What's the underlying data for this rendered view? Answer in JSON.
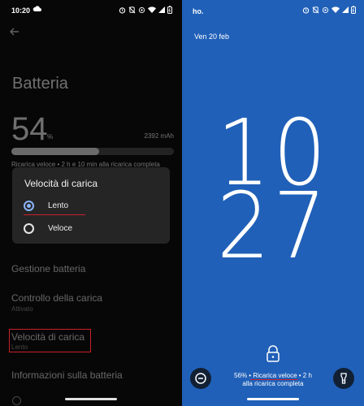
{
  "left": {
    "status_bar": {
      "time": "10:20"
    },
    "title": "Batteria",
    "battery": {
      "percent_value": "54",
      "percent_sym": "%",
      "level": 0.54,
      "capacity": "2392 mAh",
      "charge_info": "Ricarica veloce • 2 h e 10 min alla ricarica completa"
    },
    "dialog": {
      "title": "Velocità di carica",
      "options": [
        {
          "label": "Lento",
          "selected": true
        },
        {
          "label": "Veloce",
          "selected": false
        }
      ]
    },
    "settings": [
      {
        "title": "Gestione batteria",
        "subtitle": ""
      },
      {
        "title": "Controllo della carica",
        "subtitle": "Attivato"
      },
      {
        "title": "Velocità di carica",
        "subtitle": "Lento"
      },
      {
        "title": "Informazioni sulla batteria",
        "subtitle": ""
      }
    ]
  },
  "right": {
    "status_bar": {
      "carrier": "ho."
    },
    "date": "Ven 20 feb",
    "clock": {
      "hours": "10",
      "minutes": "27"
    },
    "charge_line1": "56% • Ricarica veloce • 2 h",
    "charge_line2": "alla ricarica completa",
    "left_shortcut_icon": "do-not-disturb-icon",
    "right_shortcut_icon": "flashlight-icon"
  },
  "colors": {
    "left_bg": "#070707",
    "right_bg": "#2060b8",
    "accent_radio": "#8ab4f8",
    "annotation_red": "#c8202a"
  }
}
